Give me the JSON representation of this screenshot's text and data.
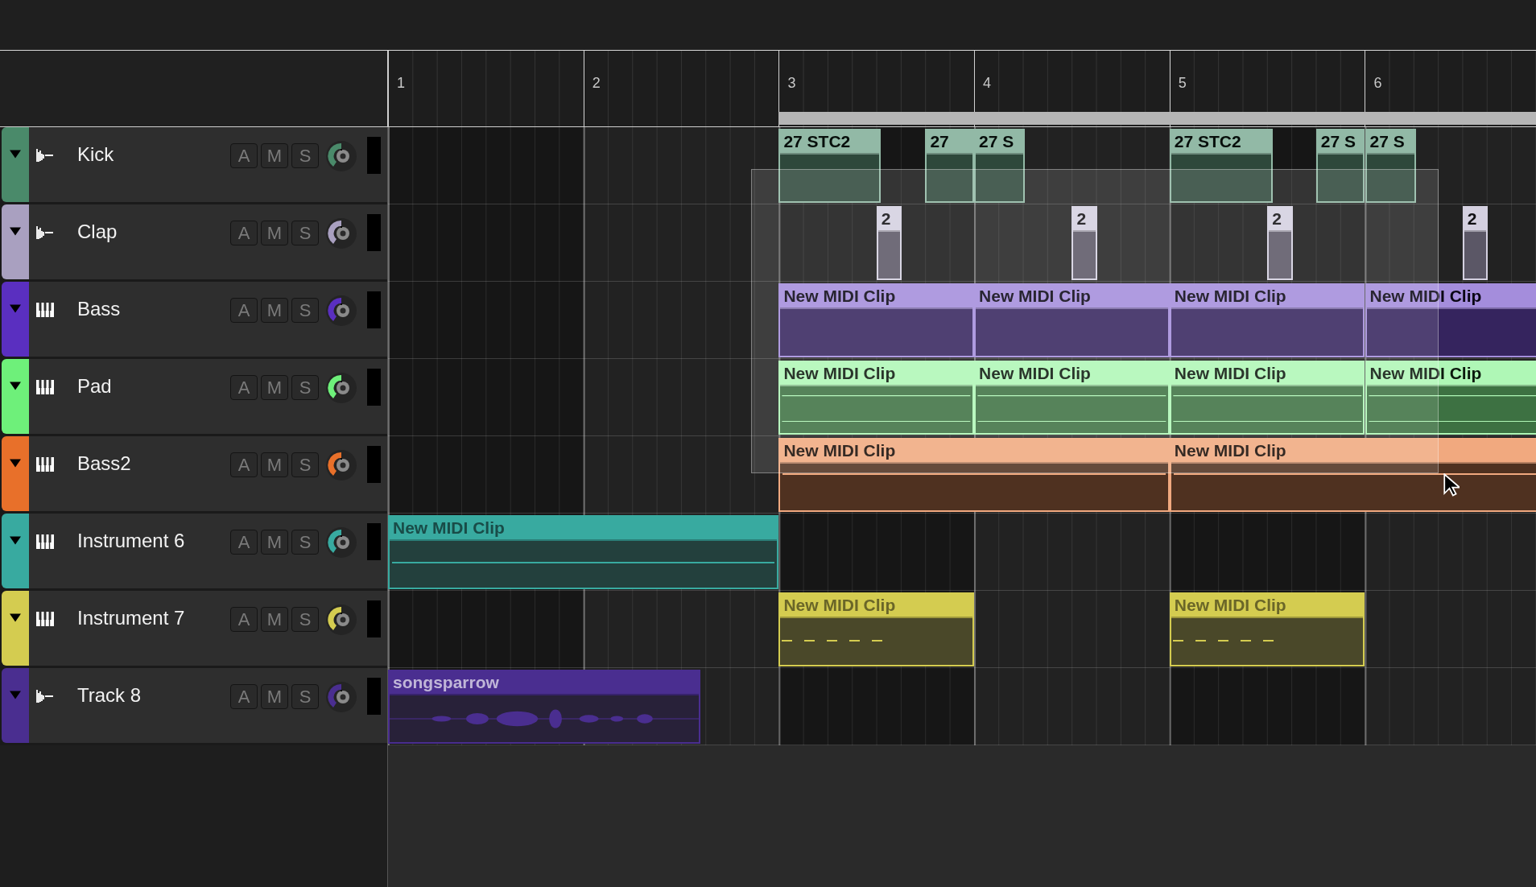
{
  "ruler": {
    "bars": [
      "1",
      "2",
      "3",
      "4",
      "5",
      "6"
    ]
  },
  "tracks": [
    {
      "name": "Kick",
      "kind": "audio",
      "color": "#4a8a6a",
      "buttons": [
        "A",
        "M",
        "S"
      ],
      "clips": [
        {
          "name": "27 STC2"
        },
        {
          "name": "27"
        },
        {
          "name": "27 S"
        },
        {
          "name": "27 STC2"
        },
        {
          "name": "27 S"
        },
        {
          "name": "27 S"
        }
      ]
    },
    {
      "name": "Clap",
      "kind": "audio",
      "color": "#a9a0c0",
      "buttons": [
        "A",
        "M",
        "S"
      ],
      "clips": [
        {
          "name": "2"
        },
        {
          "name": "2"
        },
        {
          "name": "2"
        },
        {
          "name": "2"
        }
      ]
    },
    {
      "name": "Bass",
      "kind": "instrument",
      "color": "#5a2fc0",
      "buttons": [
        "A",
        "M",
        "S"
      ],
      "clips": [
        {
          "name": "New MIDI Clip"
        },
        {
          "name": "New MIDI Clip"
        },
        {
          "name": "New MIDI Clip"
        },
        {
          "name": "New MIDI Clip"
        }
      ]
    },
    {
      "name": "Pad",
      "kind": "instrument",
      "color": "#6ef07a",
      "buttons": [
        "A",
        "M",
        "S"
      ],
      "clips": [
        {
          "name": "New MIDI Clip"
        },
        {
          "name": "New MIDI Clip"
        },
        {
          "name": "New MIDI Clip"
        },
        {
          "name": "New MIDI Clip"
        }
      ]
    },
    {
      "name": "Bass2",
      "kind": "instrument",
      "color": "#e8702a",
      "buttons": [
        "A",
        "M",
        "S"
      ],
      "clips": [
        {
          "name": "New MIDI Clip"
        },
        {
          "name": "New MIDI Clip"
        }
      ]
    },
    {
      "name": "Instrument 6",
      "kind": "instrument",
      "color": "#38aaa0",
      "buttons": [
        "A",
        "M",
        "S"
      ],
      "clips": [
        {
          "name": "New MIDI Clip"
        }
      ]
    },
    {
      "name": "Instrument 7",
      "kind": "instrument",
      "color": "#d4cc50",
      "buttons": [
        "A",
        "M",
        "S"
      ],
      "clips": [
        {
          "name": "New MIDI Clip"
        },
        {
          "name": "New MIDI Clip"
        }
      ]
    },
    {
      "name": "Track 8",
      "kind": "audio",
      "color": "#4a2e90",
      "buttons": [
        "A",
        "M",
        "S"
      ],
      "clips": [
        {
          "name": "songsparrow"
        }
      ]
    }
  ]
}
